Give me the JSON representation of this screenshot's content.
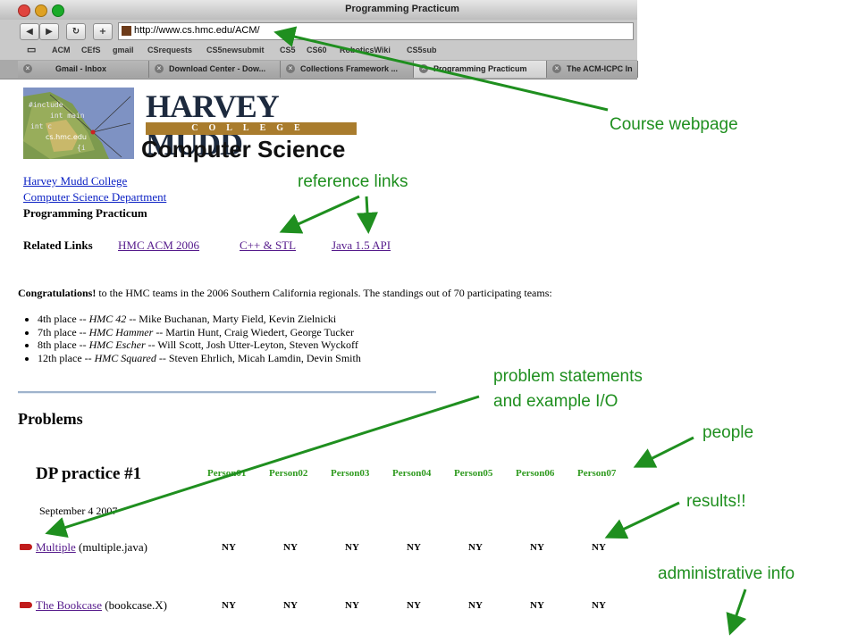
{
  "browser": {
    "window_title": "Programming Practicum",
    "url": "http://www.cs.hmc.edu/ACM/",
    "nav": {
      "back": "◀",
      "forward": "▶",
      "reload": "↻",
      "add": "+"
    },
    "bookmarks": [
      "ACM",
      "CEfS",
      "gmail",
      "CSrequests",
      "CS5newsubmit",
      "CS5",
      "CS60",
      "RoboticsWiki",
      "CS5sub"
    ],
    "tabs": [
      {
        "label": "Gmail - Inbox"
      },
      {
        "label": "Download Center - Dow..."
      },
      {
        "label": "Collections Framework ..."
      },
      {
        "label": "Programming Practicum",
        "active": true
      },
      {
        "label": "The ACM-ICPC In"
      }
    ],
    "colors": {
      "close": "#e0443e",
      "minimize": "#dea123",
      "zoom": "#1aab29"
    }
  },
  "header": {
    "logo_caption": "cs.hmc.edu",
    "logo_code": [
      "#include",
      "int main",
      "int c",
      "{i"
    ],
    "college_name": "HARVEY MUDD",
    "college_word": "COLLEGE",
    "department": "Computer Science"
  },
  "breadcrumbs": [
    "Harvey Mudd College",
    "Computer Science Department",
    "Programming Practicum"
  ],
  "related": {
    "label": "Related Links",
    "links": [
      "HMC ACM 2006",
      "C++ & STL",
      "Java 1.5 API"
    ]
  },
  "congrats": {
    "lead": "Congratulations!",
    "text": " to the HMC teams in the 2006 Southern California regionals. The standings out of 70 participating teams:",
    "items": [
      {
        "place": "4th place -- ",
        "team": "HMC 42",
        "members": " -- Mike Buchanan, Marty Field, Kevin Zielnicki"
      },
      {
        "place": "7th place -- ",
        "team": "HMC Hammer",
        "members": " -- Martin Hunt, Craig Wiedert, George Tucker"
      },
      {
        "place": "8th place -- ",
        "team": "HMC Escher",
        "members": " -- Will Scott, Josh Utter-Leyton, Steven Wyckoff"
      },
      {
        "place": "12th place -- ",
        "team": "HMC Squared",
        "members": " -- Steven Ehrlich, Micah Lamdin, Devin Smith"
      }
    ]
  },
  "problems": {
    "heading": "Problems",
    "practice_title": "DP practice #1",
    "date": "September 4 2007",
    "people": [
      "Person01",
      "Person02",
      "Person03",
      "Person04",
      "Person05",
      "Person06",
      "Person07"
    ],
    "rows": [
      {
        "name": "Multiple",
        "file": " (multiple.java)",
        "results": [
          "NY",
          "NY",
          "NY",
          "NY",
          "NY",
          "NY",
          "NY"
        ]
      },
      {
        "name": "The Bookcase",
        "file": " (bookcase.X)",
        "results": [
          "NY",
          "NY",
          "NY",
          "NY",
          "NY",
          "NY",
          "NY"
        ]
      }
    ]
  },
  "annotations": {
    "course_webpage": "Course webpage",
    "reference_links": "reference links",
    "problem_statements_1": "problem statements",
    "problem_statements_2": "and example I/O",
    "people": "people",
    "results": "results!!",
    "admin": "administrative info",
    "color": "#1f8f1f"
  }
}
